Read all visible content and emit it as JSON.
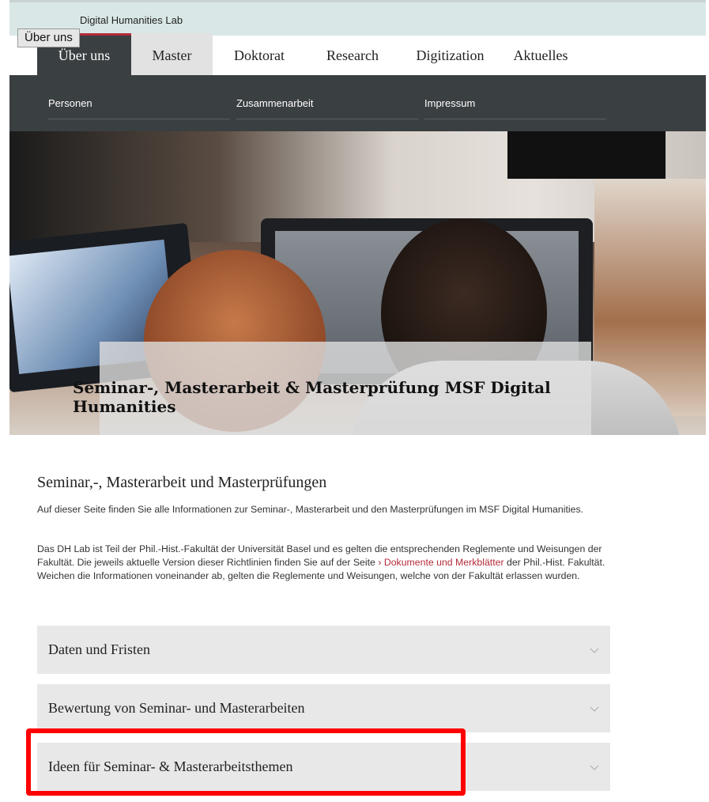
{
  "site": {
    "name": "Digital Humanities Lab"
  },
  "tooltip": "Über uns",
  "nav": {
    "tabs": [
      "Über uns",
      "Master",
      "Doktorat",
      "Research",
      "Digitization",
      "Aktuelles"
    ]
  },
  "subnav": {
    "items": [
      "Personen",
      "Zusammenarbeit",
      "Impressum"
    ]
  },
  "hero": {
    "title": "Seminar-, Masterarbeit & Masterprüfung MSF Digital Humanities"
  },
  "main": {
    "heading": "Seminar,-, Masterarbeit und Masterprüfungen",
    "para1": "Auf dieser Seite finden Sie alle Informationen zur Seminar-, Masterarbeit und den Masterprüfungen im MSF Digital Humanities.",
    "para2_start": "Das DH Lab ist Teil der Phil.-Hist.-Fakultät der Universität Basel und es gelten die entsprechenden Reglemente und Weisungen der Fakultät. Die jeweils aktuelle Version dieser Richtlinien finden Sie auf der Seite ",
    "para2_link": "› Dokumente und Merkblätter",
    "para2_end": " der Phil.-Hist. Fakultät. Weichen die Informationen voneinander ab, gelten die Reglemente und Weisungen, welche von der Fakultät erlassen wurden."
  },
  "accordions": [
    "Daten und Fristen",
    "Bewertung von Seminar- und Masterarbeiten",
    "Ideen für Seminar- & Masterarbeitsthemen"
  ],
  "icons": {
    "accordion_chevron": "chevron-down-icon"
  },
  "colors": {
    "accent": "#b42b3a",
    "nav_dark": "#3a3f41",
    "top_strip": "#d9e8e6",
    "highlight": "#ff0000"
  }
}
